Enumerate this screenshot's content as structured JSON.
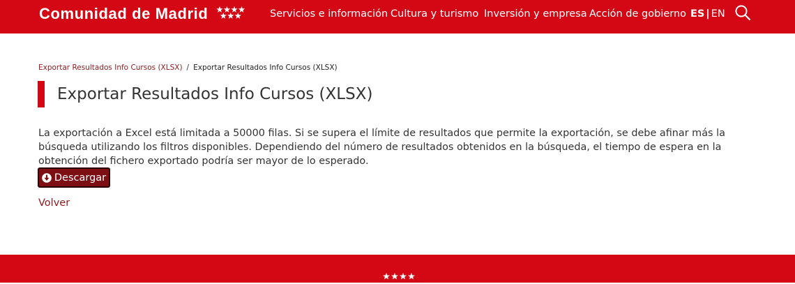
{
  "header": {
    "logo_text": "Comunidad de Madrid",
    "nav": [
      {
        "label": "Servicios e información"
      },
      {
        "label": "Cultura y turismo"
      },
      {
        "label": "Inversión y empresa"
      },
      {
        "label": "Acción de gobierno"
      }
    ],
    "lang": {
      "es": "ES",
      "separator": "|",
      "en": "EN"
    },
    "search_icon": "search-icon"
  },
  "breadcrumb": {
    "items": [
      {
        "label": "Exportar Resultados Info Cursos (XLSX)"
      },
      {
        "label": "Exportar Resultados Info Cursos (XLSX)"
      }
    ],
    "separator": "/"
  },
  "main": {
    "title": "Exportar Resultados Info Cursos (XLSX)",
    "intro": "La exportación a Excel está limitada a 50000 filas. Si se supera el límite de resultados que permite la exportación, se debe afinar más la búsqueda utilizando los filtros disponibles. Dependiendo del número de resultados obtenidos en la búsqueda, el tiempo de espera en la obtención del fichero exportado podría ser mayor de lo esperado.",
    "download_label": "Descargar",
    "download_icon": "download-circle-icon",
    "back_label": "Volver"
  },
  "colors": {
    "brand_red": "#d40814",
    "dark_red": "#7d0e14",
    "link_red": "#8b1a1f",
    "text": "#333333"
  }
}
